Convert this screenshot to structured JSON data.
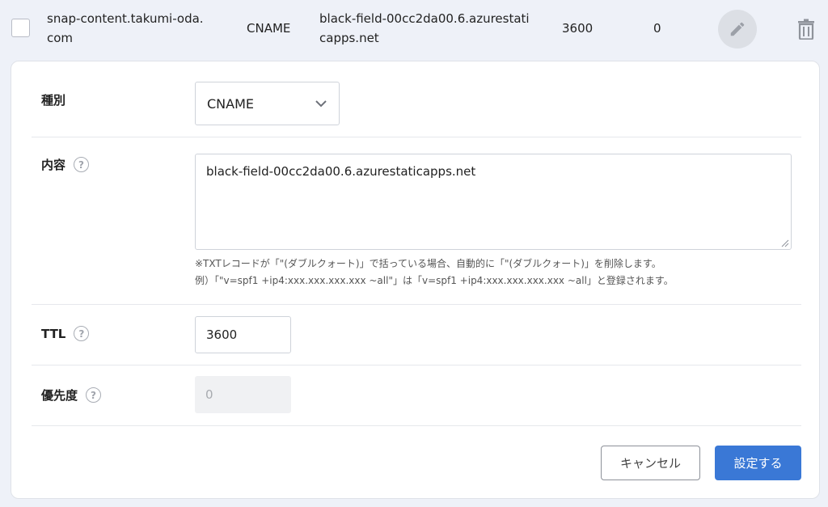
{
  "record": {
    "name": "snap-content.takumi-oda.com",
    "type": "CNAME",
    "content": "black-field-00cc2da00.6.azurestaticapps.net",
    "ttl": "3600",
    "priority": "0"
  },
  "icons": {
    "edit": "pencil-icon",
    "delete": "trash-icon",
    "help": "question-circle-icon",
    "select": "chevron-down-icon"
  },
  "form": {
    "type_label": "種別",
    "type_value": "CNAME",
    "content_label": "内容",
    "content_value": "black-field-00cc2da00.6.azurestaticapps.net",
    "content_note_line1": "※TXTレコードが「\"(ダブルクォート)」で括っている場合、自動的に「\"(ダブルクォート)」を削除します。",
    "content_note_line2": "例）「\"v=spf1 +ip4:xxx.xxx.xxx.xxx ~all\"」は「v=spf1 +ip4:xxx.xxx.xxx.xxx ~all」と登録されます。",
    "ttl_label": "TTL",
    "ttl_value": "3600",
    "priority_label": "優先度",
    "priority_value": "0",
    "help_glyph": "?"
  },
  "actions": {
    "cancel_label": "キャンセル",
    "submit_label": "設定する"
  },
  "colors": {
    "primary": "#3a78d6",
    "background": "#eef1f8"
  }
}
